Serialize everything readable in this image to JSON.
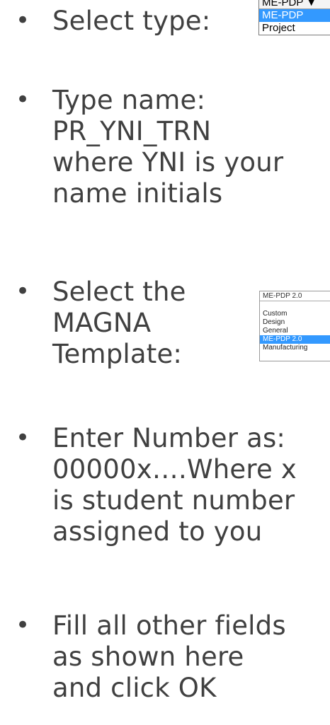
{
  "bullet_glyph": "•",
  "items": [
    {
      "lines": [
        "Select type:"
      ]
    },
    {
      "lines": [
        "Type name:",
        "PR_YNI_TRN",
        "where YNI is your",
        "name initials"
      ]
    },
    {
      "lines": [
        "Select the",
        "MAGNA",
        "Template:"
      ]
    },
    {
      "lines": [
        "Enter Number as:",
        "00000x….Where x",
        "is student number",
        "assigned to you"
      ]
    },
    {
      "lines": [
        "Fill all other fields",
        "as shown here",
        "and click OK"
      ]
    }
  ],
  "type_dropdown": {
    "selected": "ME-PDP ▼",
    "options": [
      "ME-PDP",
      "Project"
    ],
    "highlighted_index": 0
  },
  "template_dropdown": {
    "selected": "ME-PDP 2.0",
    "options": [
      "Custom",
      "Design",
      "General",
      "ME-PDP 2.0",
      "Manufacturing"
    ],
    "highlighted_index": 3
  },
  "colors": {
    "text": "#404040",
    "highlight": "#3399ff"
  }
}
